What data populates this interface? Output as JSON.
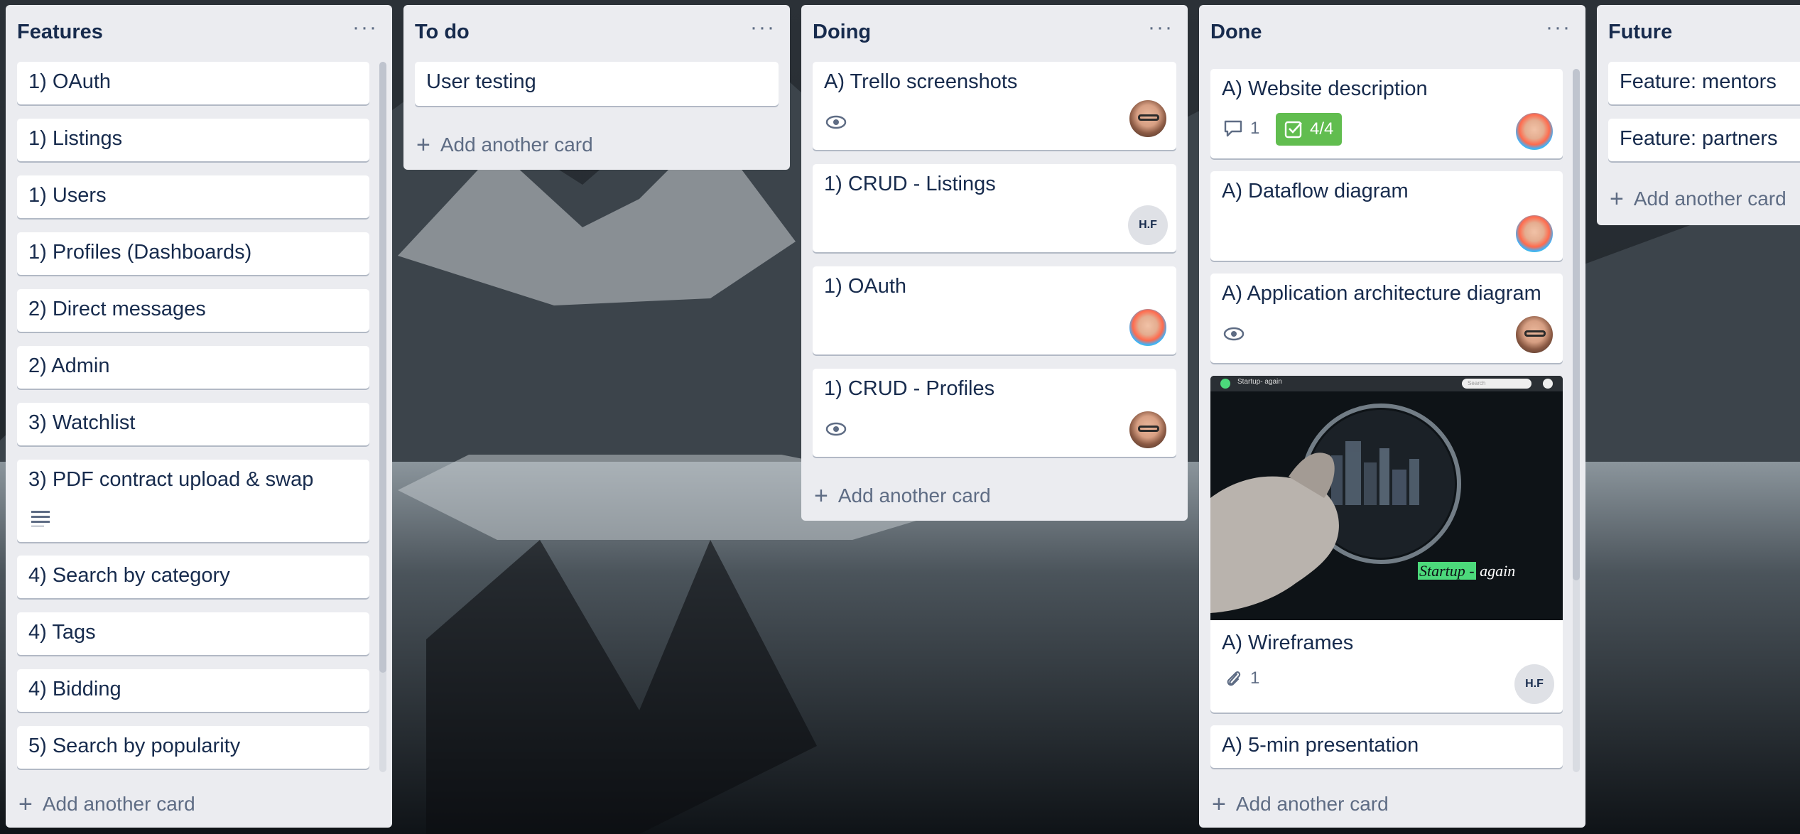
{
  "lists": [
    {
      "title": "Features",
      "cards": [
        {
          "title": "1) OAuth"
        },
        {
          "title": "1) Listings"
        },
        {
          "title": "1) Users"
        },
        {
          "title": "1) Profiles (Dashboards)"
        },
        {
          "title": "2) Direct messages"
        },
        {
          "title": "2) Admin"
        },
        {
          "title": "3) Watchlist"
        },
        {
          "title": "3) PDF contract upload & swap",
          "icon": "description-icon"
        },
        {
          "title": "4) Search by category"
        },
        {
          "title": "4) Tags"
        },
        {
          "title": "4) Bidding"
        },
        {
          "title": "5) Search by popularity"
        }
      ],
      "add_label": "Add another card"
    },
    {
      "title": "To do",
      "cards": [
        {
          "title": "User testing"
        }
      ],
      "add_label": "Add another card"
    },
    {
      "title": "Doing",
      "cards": [
        {
          "title": "A) Trello screenshots",
          "icon": "eye-icon",
          "avatar": "avatar-photo"
        },
        {
          "title": "1) CRUD - Listings",
          "avatar_initials": "H.F"
        },
        {
          "title": "1) OAuth",
          "avatar": "avatar-colorful"
        },
        {
          "title": "1) CRUD - Profiles",
          "icon": "eye-icon",
          "avatar": "avatar-photo"
        }
      ],
      "add_label": "Add another card"
    },
    {
      "title": "Done",
      "cards": [
        {
          "title": "A) Website description",
          "comments": "1",
          "checklist": "4/4",
          "avatar": "avatar-colorful"
        },
        {
          "title": "A) Dataflow diagram",
          "avatar": "avatar-colorful"
        },
        {
          "title": "A) Application architecture diagram",
          "icon": "eye-icon",
          "avatar": "avatar-photo"
        },
        {
          "title": "A) Wireframes",
          "attachments": "1",
          "avatar_initials": "H.F",
          "cover": {
            "site_name": "Startup- again",
            "search_placeholder": "Search",
            "brand_text_1": "Startup -",
            "brand_text_2": "again"
          }
        },
        {
          "title": "A) 5-min presentation"
        }
      ],
      "add_label": "Add another card"
    },
    {
      "title": "Future",
      "cards": [
        {
          "title": "Feature: mentors"
        },
        {
          "title": "Feature: partners"
        }
      ],
      "add_label": "Add another card"
    }
  ],
  "menu_glyph": "···",
  "colors": {
    "list_bg": "#ebecf0",
    "card_bg": "#ffffff",
    "checklist_green": "#61bd4f",
    "text": "#172b4d",
    "muted": "#5e6c84"
  }
}
